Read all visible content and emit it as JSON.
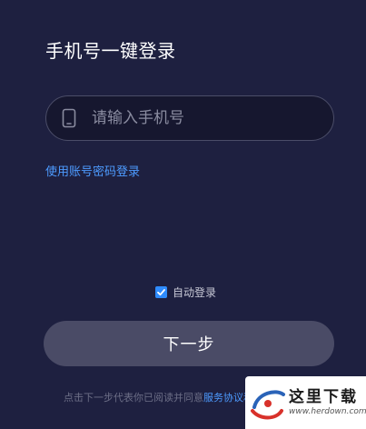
{
  "login": {
    "title": "手机号一键登录",
    "phone_placeholder": "请输入手机号",
    "phone_value": "",
    "alt_login_link": "使用账号密码登录",
    "auto_login_label": "自动登录",
    "auto_login_checked": true,
    "next_button": "下一步",
    "agreement_prefix": "点击下一步代表你已阅读并同意",
    "agreement_link": "服务协议和隐私政策"
  },
  "watermark": {
    "name": "这里下载",
    "url": "www.herdown.com"
  },
  "colors": {
    "background": "#1e2040",
    "input_background": "#16172f",
    "input_border": "#4b4d68",
    "link": "#4d9bff",
    "checkbox": "#2f8cff",
    "button": "#4a4b66"
  },
  "icons": {
    "phone": "phone-icon",
    "checkbox": "checkmark-icon",
    "watermark_logo": "site-logo-icon"
  }
}
